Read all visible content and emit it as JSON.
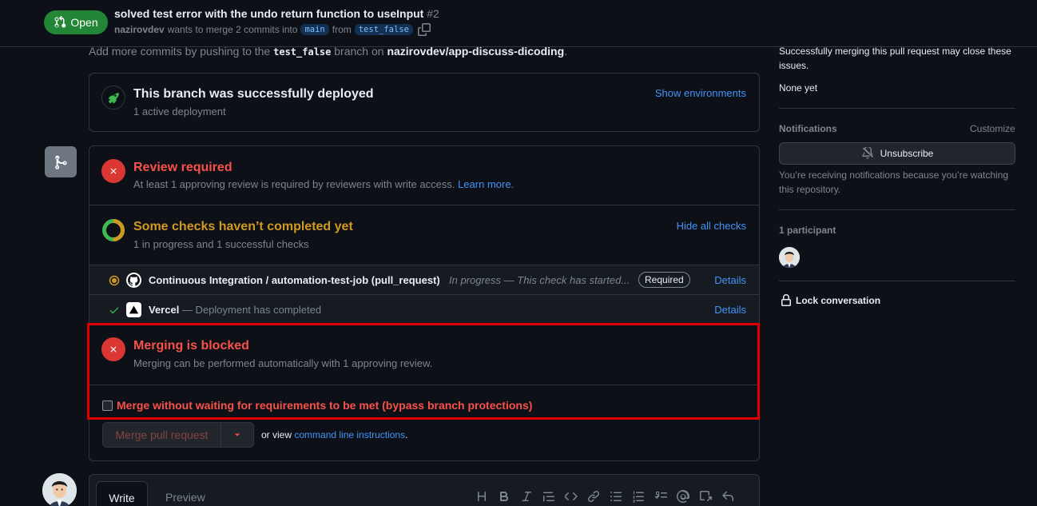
{
  "header": {
    "state": "Open",
    "title": "solved test error with the undo return function to useInput",
    "number": "#2",
    "author": "nazirovdev",
    "merge_text": "wants to merge 2 commits into",
    "base_branch": "main",
    "from_text": "from",
    "head_branch": "test_false"
  },
  "hint": {
    "prefix": "Add more commits by pushing to the",
    "branch": "test_false",
    "middle": "branch on",
    "repo": "nazirovdev/app-discuss-dicoding",
    "suffix": "."
  },
  "deploy": {
    "title": "This branch was successfully deployed",
    "subtitle": "1 active deployment",
    "show_envs": "Show environments"
  },
  "review": {
    "title": "Review required",
    "subtitle": "At least 1 approving review is required by reviewers with write access.",
    "learn_more": "Learn more."
  },
  "checks": {
    "title": "Some checks haven’t completed yet",
    "subtitle": "1 in progress and 1 successful checks",
    "hide": "Hide all checks",
    "items": [
      {
        "name": "Continuous Integration / automation-test-job (pull_request)",
        "desc": "In progress — This check has started...",
        "badge": "Required",
        "details": "Details"
      },
      {
        "name": "Vercel",
        "desc": " — Deployment has completed",
        "details": "Details"
      }
    ]
  },
  "blocked": {
    "title": "Merging is blocked",
    "subtitle": "Merging can be performed automatically with 1 approving review.",
    "bypass": "Merge without waiting for requirements to be met (bypass branch protections)"
  },
  "merge": {
    "button": "Merge pull request",
    "or_view": "or view",
    "cli_link": "command line instructions",
    "period": "."
  },
  "comment": {
    "write_tab": "Write",
    "preview_tab": "Preview"
  },
  "sidebar": {
    "dev_note": "Successfully merging this pull request may close these issues.",
    "none_yet": "None yet",
    "notifications_heading": "Notifications",
    "customize": "Customize",
    "unsubscribe": "Unsubscribe",
    "notif_reason": "You’re receiving notifications because you’re watching this repository.",
    "participants": "1 participant",
    "lock": "Lock conversation"
  },
  "colors": {
    "danger": "#f85149",
    "attention": "#d29922",
    "success": "#238636",
    "accent": "#4493f8"
  }
}
